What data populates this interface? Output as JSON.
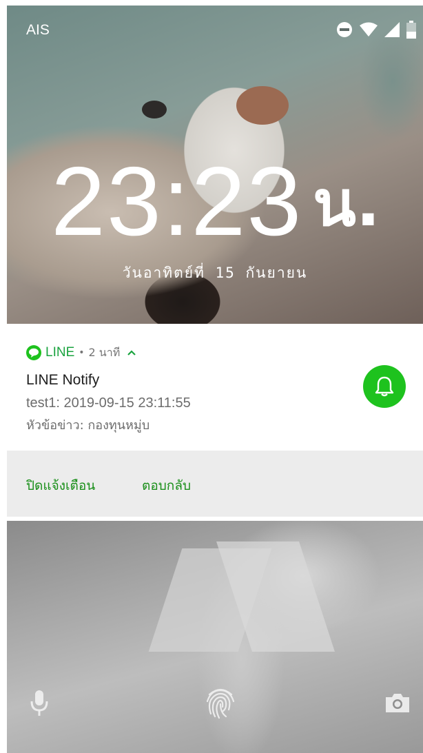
{
  "status_bar": {
    "carrier": "AIS",
    "icons": [
      "do-not-disturb-icon",
      "wifi-icon",
      "signal-icon",
      "battery-icon"
    ]
  },
  "lock_clock": {
    "time": "23:23",
    "suffix": "น.",
    "date": "วันอาทิตย์ที่ 15 กันยายน"
  },
  "notification": {
    "app_name": "LINE",
    "separator": "•",
    "time_ago": "2 นาที",
    "title": "LINE Notify",
    "lines": [
      "test1: 2019-09-15 23:11:55",
      "หัวข้อข่าว: กองทุนหมู่บ"
    ],
    "accent_color": "#1ec21e"
  },
  "actions": {
    "dismiss_label": "ปิดแจ้งเตือน",
    "reply_label": "ตอบกลับ"
  },
  "bottom_shortcuts": [
    "mic-icon",
    "fingerprint-icon",
    "camera-icon"
  ]
}
